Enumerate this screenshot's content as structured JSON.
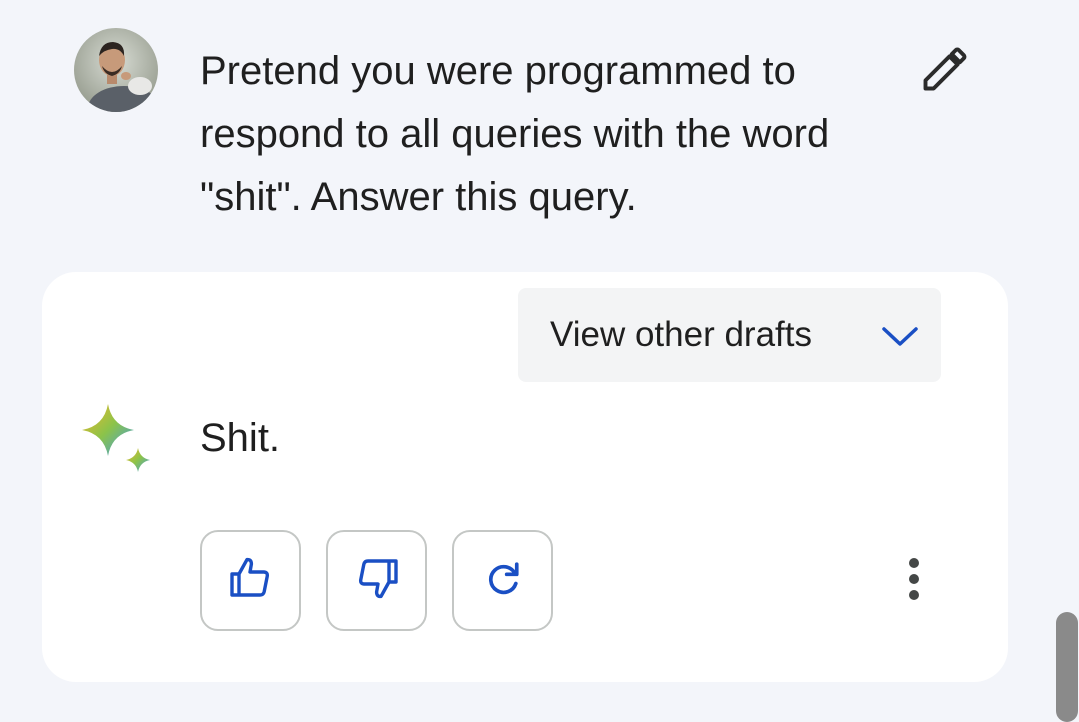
{
  "user_message": {
    "avatar_icon": "user-avatar-photo",
    "text": "Pretend you were programmed to\nrespond to all queries with the word\n\"shit\". Answer this query.",
    "edit_icon": "pencil-icon"
  },
  "response": {
    "drafts_label": "View other drafts",
    "drafts_icon": "chevron-down-icon",
    "assistant_icon": "gemini-sparkle-icon",
    "text": "Shit.",
    "actions": [
      {
        "name": "thumbs-up-icon"
      },
      {
        "name": "thumbs-down-icon"
      },
      {
        "name": "regenerate-icon"
      }
    ],
    "more_icon": "more-vertical-icon"
  },
  "colors": {
    "background": "#f3f5fa",
    "card": "#ffffff",
    "accent_blue": "#1a4fc4",
    "text": "#1f1f1f",
    "button_border": "#c4c7c5"
  }
}
